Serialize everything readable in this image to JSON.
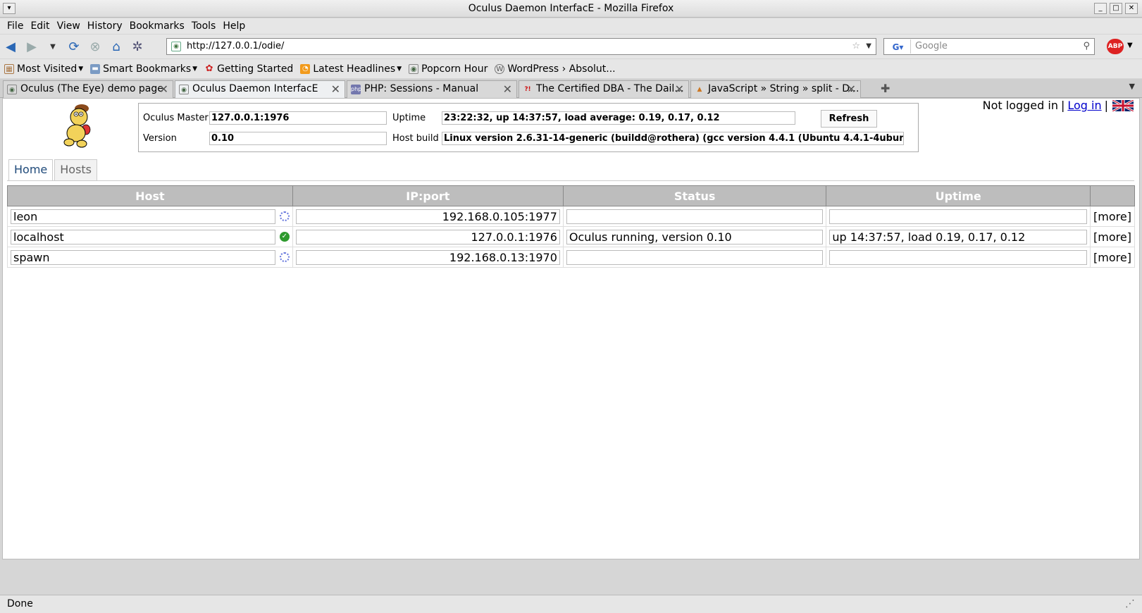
{
  "window": {
    "title": "Oculus Daemon InterfacE - Mozilla Firefox"
  },
  "menu": [
    "File",
    "Edit",
    "View",
    "History",
    "Bookmarks",
    "Tools",
    "Help"
  ],
  "navbar": {
    "url": "http://127.0.0.1/odie/",
    "search_placeholder": "Google"
  },
  "bookmarks": [
    {
      "label": "Most Visited",
      "icon": "most-visited-icon",
      "dropdown": true
    },
    {
      "label": "Smart Bookmarks",
      "icon": "folder-icon",
      "dropdown": true
    },
    {
      "label": "Getting Started",
      "icon": "firefox-icon",
      "dropdown": false
    },
    {
      "label": "Latest Headlines",
      "icon": "rss-icon",
      "dropdown": true
    },
    {
      "label": "Popcorn Hour",
      "icon": "page-icon",
      "dropdown": false
    },
    {
      "label": "WordPress › Absolut...",
      "icon": "wordpress-icon",
      "dropdown": false
    }
  ],
  "tabs": [
    {
      "label": "Oculus (The Eye) demo page",
      "active": false
    },
    {
      "label": "Oculus Daemon InterfacE",
      "active": true
    },
    {
      "label": "PHP: Sessions - Manual",
      "active": false
    },
    {
      "label": "The Certified DBA - The Dail...",
      "active": false
    },
    {
      "label": "JavaScript » String » split - D...",
      "active": false
    }
  ],
  "page": {
    "login": {
      "status": "Not logged in",
      "separator": "|",
      "link": "Log in"
    },
    "info": {
      "master_label": "Oculus Master",
      "master_value": "127.0.0.1:1976",
      "version_label": "Version",
      "version_value": "0.10",
      "uptime_label": "Uptime",
      "uptime_value": "23:22:32, up 14:37:57, load average: 0.19, 0.17, 0.12",
      "hostbuild_label": "Host build",
      "hostbuild_value": "Linux version 2.6.31-14-generic (buildd@rothera) (gcc version 4.4.1 (Ubuntu 4.4.1-4ubun",
      "refresh_label": "Refresh"
    },
    "tabs": [
      "Home",
      "Hosts"
    ],
    "table": {
      "headers": [
        "Host",
        "IP:port",
        "Status",
        "Uptime",
        ""
      ],
      "rows": [
        {
          "host": "leon",
          "state": "loading",
          "ipport": "192.168.0.105:1977",
          "status": "",
          "uptime": "",
          "more": "[more]"
        },
        {
          "host": "localhost",
          "state": "ok",
          "ipport": "127.0.0.1:1976",
          "status": "Oculus running, version 0.10",
          "uptime": "up 14:37:57, load 0.19, 0.17, 0.12",
          "more": "[more]"
        },
        {
          "host": "spawn",
          "state": "loading",
          "ipport": "192.168.0.13:1970",
          "status": "",
          "uptime": "",
          "more": "[more]"
        }
      ]
    }
  },
  "statusbar": {
    "text": "Done"
  }
}
